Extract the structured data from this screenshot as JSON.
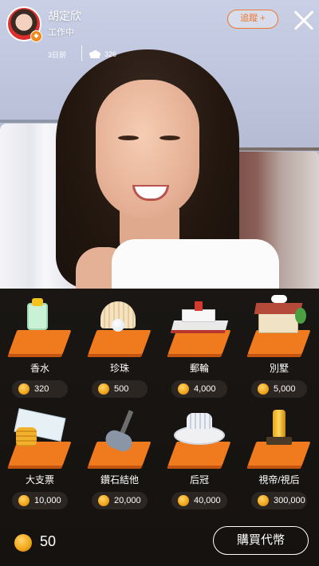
{
  "host": {
    "name": "胡定欣",
    "status": "工作中",
    "time_ago": "3日前",
    "viewer_count": "326",
    "badge_icon": "fire-badge-icon",
    "avatar_color": "#d32424"
  },
  "header": {
    "follow_label": "追蹤 +",
    "close_icon": "close-icon",
    "accent_color": "#f0772a"
  },
  "gifts": [
    {
      "name": "香水",
      "price": "320",
      "icon": "perfume-icon"
    },
    {
      "name": "珍珠",
      "price": "500",
      "icon": "pearl-icon"
    },
    {
      "name": "郵輪",
      "price": "4,000",
      "icon": "cruise-ship-icon"
    },
    {
      "name": "別墅",
      "price": "5,000",
      "icon": "villa-icon"
    },
    {
      "name": "大支票",
      "price": "10,000",
      "icon": "big-cheque-icon"
    },
    {
      "name": "鑽石結他",
      "price": "20,000",
      "icon": "diamond-guitar-icon"
    },
    {
      "name": "后冠",
      "price": "40,000",
      "icon": "crown-icon"
    },
    {
      "name": "視帝/視后",
      "price": "300,000",
      "icon": "trophy-icon"
    }
  ],
  "footer": {
    "balance": "50",
    "buy_label": "購買代幣",
    "coin_color": "#f2a91d"
  }
}
